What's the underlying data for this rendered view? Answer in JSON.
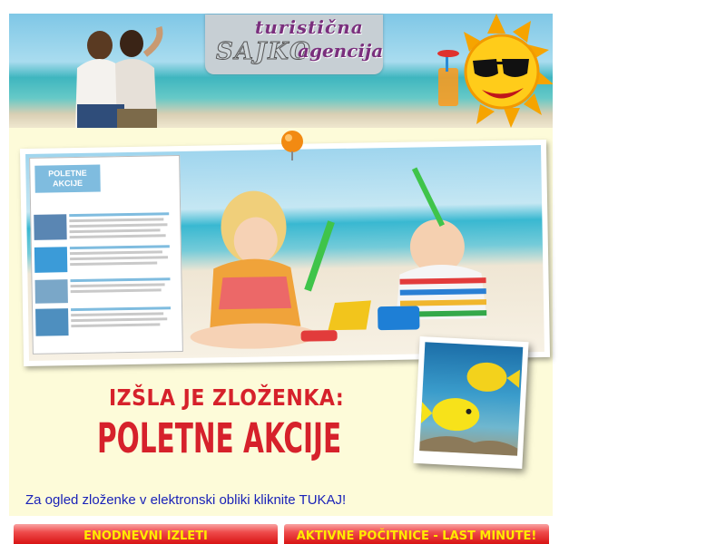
{
  "header": {
    "logo_line1": "turistična",
    "logo_brand": "SAJKO",
    "logo_line2": "agencija"
  },
  "flyer": {
    "brochure_title": "POLETNE AKCIJE",
    "heading_small": "IZŠLA JE ZLOŽENKA:",
    "heading_large": "POLETNE AKCIJE"
  },
  "link_text": "Za ogled zloženke v elektronski obliki kliknite TUKAJ!",
  "nav": {
    "izleti_label": "ENODNEVNI IZLETI",
    "aktivne_label": "AKTIVNE POČITNICE - LAST MINUTE!"
  },
  "colors": {
    "accent_red": "#d6212b",
    "link_blue": "#1a22b8",
    "button_text": "#ffea00",
    "panel_bg": "#fdfbd9"
  }
}
